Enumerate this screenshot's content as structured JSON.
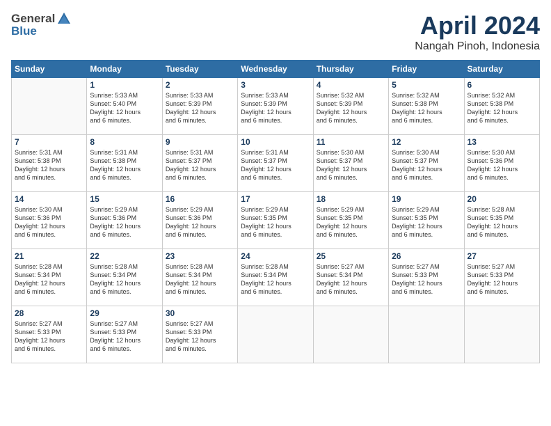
{
  "header": {
    "logo_general": "General",
    "logo_blue": "Blue",
    "main_title": "April 2024",
    "subtitle": "Nangah Pinoh, Indonesia"
  },
  "calendar": {
    "days_of_week": [
      "Sunday",
      "Monday",
      "Tuesday",
      "Wednesday",
      "Thursday",
      "Friday",
      "Saturday"
    ],
    "weeks": [
      [
        {
          "day": "",
          "sunrise": "",
          "sunset": "",
          "daylight": ""
        },
        {
          "day": "1",
          "sunrise": "Sunrise: 5:33 AM",
          "sunset": "Sunset: 5:40 PM",
          "daylight": "Daylight: 12 hours and 6 minutes."
        },
        {
          "day": "2",
          "sunrise": "Sunrise: 5:33 AM",
          "sunset": "Sunset: 5:39 PM",
          "daylight": "Daylight: 12 hours and 6 minutes."
        },
        {
          "day": "3",
          "sunrise": "Sunrise: 5:33 AM",
          "sunset": "Sunset: 5:39 PM",
          "daylight": "Daylight: 12 hours and 6 minutes."
        },
        {
          "day": "4",
          "sunrise": "Sunrise: 5:32 AM",
          "sunset": "Sunset: 5:39 PM",
          "daylight": "Daylight: 12 hours and 6 minutes."
        },
        {
          "day": "5",
          "sunrise": "Sunrise: 5:32 AM",
          "sunset": "Sunset: 5:38 PM",
          "daylight": "Daylight: 12 hours and 6 minutes."
        },
        {
          "day": "6",
          "sunrise": "Sunrise: 5:32 AM",
          "sunset": "Sunset: 5:38 PM",
          "daylight": "Daylight: 12 hours and 6 minutes."
        }
      ],
      [
        {
          "day": "7",
          "sunrise": "Sunrise: 5:31 AM",
          "sunset": "Sunset: 5:38 PM",
          "daylight": "Daylight: 12 hours and 6 minutes."
        },
        {
          "day": "8",
          "sunrise": "Sunrise: 5:31 AM",
          "sunset": "Sunset: 5:38 PM",
          "daylight": "Daylight: 12 hours and 6 minutes."
        },
        {
          "day": "9",
          "sunrise": "Sunrise: 5:31 AM",
          "sunset": "Sunset: 5:37 PM",
          "daylight": "Daylight: 12 hours and 6 minutes."
        },
        {
          "day": "10",
          "sunrise": "Sunrise: 5:31 AM",
          "sunset": "Sunset: 5:37 PM",
          "daylight": "Daylight: 12 hours and 6 minutes."
        },
        {
          "day": "11",
          "sunrise": "Sunrise: 5:30 AM",
          "sunset": "Sunset: 5:37 PM",
          "daylight": "Daylight: 12 hours and 6 minutes."
        },
        {
          "day": "12",
          "sunrise": "Sunrise: 5:30 AM",
          "sunset": "Sunset: 5:37 PM",
          "daylight": "Daylight: 12 hours and 6 minutes."
        },
        {
          "day": "13",
          "sunrise": "Sunrise: 5:30 AM",
          "sunset": "Sunset: 5:36 PM",
          "daylight": "Daylight: 12 hours and 6 minutes."
        }
      ],
      [
        {
          "day": "14",
          "sunrise": "Sunrise: 5:30 AM",
          "sunset": "Sunset: 5:36 PM",
          "daylight": "Daylight: 12 hours and 6 minutes."
        },
        {
          "day": "15",
          "sunrise": "Sunrise: 5:29 AM",
          "sunset": "Sunset: 5:36 PM",
          "daylight": "Daylight: 12 hours and 6 minutes."
        },
        {
          "day": "16",
          "sunrise": "Sunrise: 5:29 AM",
          "sunset": "Sunset: 5:36 PM",
          "daylight": "Daylight: 12 hours and 6 minutes."
        },
        {
          "day": "17",
          "sunrise": "Sunrise: 5:29 AM",
          "sunset": "Sunset: 5:35 PM",
          "daylight": "Daylight: 12 hours and 6 minutes."
        },
        {
          "day": "18",
          "sunrise": "Sunrise: 5:29 AM",
          "sunset": "Sunset: 5:35 PM",
          "daylight": "Daylight: 12 hours and 6 minutes."
        },
        {
          "day": "19",
          "sunrise": "Sunrise: 5:29 AM",
          "sunset": "Sunset: 5:35 PM",
          "daylight": "Daylight: 12 hours and 6 minutes."
        },
        {
          "day": "20",
          "sunrise": "Sunrise: 5:28 AM",
          "sunset": "Sunset: 5:35 PM",
          "daylight": "Daylight: 12 hours and 6 minutes."
        }
      ],
      [
        {
          "day": "21",
          "sunrise": "Sunrise: 5:28 AM",
          "sunset": "Sunset: 5:34 PM",
          "daylight": "Daylight: 12 hours and 6 minutes."
        },
        {
          "day": "22",
          "sunrise": "Sunrise: 5:28 AM",
          "sunset": "Sunset: 5:34 PM",
          "daylight": "Daylight: 12 hours and 6 minutes."
        },
        {
          "day": "23",
          "sunrise": "Sunrise: 5:28 AM",
          "sunset": "Sunset: 5:34 PM",
          "daylight": "Daylight: 12 hours and 6 minutes."
        },
        {
          "day": "24",
          "sunrise": "Sunrise: 5:28 AM",
          "sunset": "Sunset: 5:34 PM",
          "daylight": "Daylight: 12 hours and 6 minutes."
        },
        {
          "day": "25",
          "sunrise": "Sunrise: 5:27 AM",
          "sunset": "Sunset: 5:34 PM",
          "daylight": "Daylight: 12 hours and 6 minutes."
        },
        {
          "day": "26",
          "sunrise": "Sunrise: 5:27 AM",
          "sunset": "Sunset: 5:33 PM",
          "daylight": "Daylight: 12 hours and 6 minutes."
        },
        {
          "day": "27",
          "sunrise": "Sunrise: 5:27 AM",
          "sunset": "Sunset: 5:33 PM",
          "daylight": "Daylight: 12 hours and 6 minutes."
        }
      ],
      [
        {
          "day": "28",
          "sunrise": "Sunrise: 5:27 AM",
          "sunset": "Sunset: 5:33 PM",
          "daylight": "Daylight: 12 hours and 6 minutes."
        },
        {
          "day": "29",
          "sunrise": "Sunrise: 5:27 AM",
          "sunset": "Sunset: 5:33 PM",
          "daylight": "Daylight: 12 hours and 6 minutes."
        },
        {
          "day": "30",
          "sunrise": "Sunrise: 5:27 AM",
          "sunset": "Sunset: 5:33 PM",
          "daylight": "Daylight: 12 hours and 6 minutes."
        },
        {
          "day": "",
          "sunrise": "",
          "sunset": "",
          "daylight": ""
        },
        {
          "day": "",
          "sunrise": "",
          "sunset": "",
          "daylight": ""
        },
        {
          "day": "",
          "sunrise": "",
          "sunset": "",
          "daylight": ""
        },
        {
          "day": "",
          "sunrise": "",
          "sunset": "",
          "daylight": ""
        }
      ]
    ]
  }
}
